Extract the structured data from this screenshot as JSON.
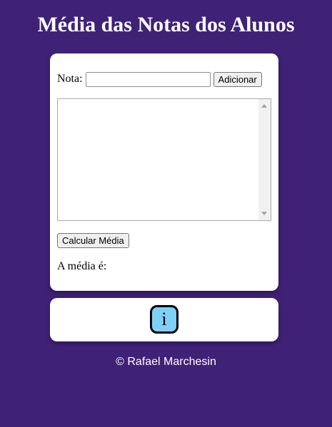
{
  "page": {
    "title": "Média das Notas dos Alunos",
    "background_color": "#3f2276"
  },
  "form": {
    "note_label": "Nota:",
    "note_input_value": "",
    "add_button_label": "Adicionar",
    "notes_list_value": "",
    "calc_button_label": "Calcular Média",
    "result_label": "A média é:",
    "result_value": ""
  },
  "info": {
    "button_label": "i",
    "button_color": "#7fd0f7"
  },
  "footer": {
    "text": "© Rafael Marchesin"
  }
}
